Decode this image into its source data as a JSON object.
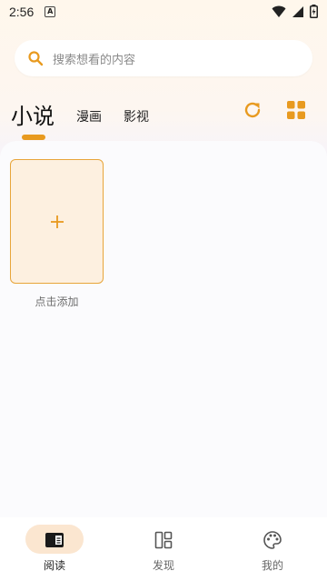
{
  "status_bar": {
    "time": "2:56",
    "app_badge": "A"
  },
  "search": {
    "placeholder": "搜索想看的内容"
  },
  "tabs": [
    {
      "label": "小说",
      "active": true
    },
    {
      "label": "漫画",
      "active": false
    },
    {
      "label": "影视",
      "active": false
    }
  ],
  "toolbar": {
    "refresh_icon": "refresh-icon",
    "grid_icon": "grid-view-icon"
  },
  "shelf": {
    "add_label": "点击添加",
    "add_icon": "plus-icon"
  },
  "bottom_nav": [
    {
      "label": "阅读",
      "icon": "book-icon",
      "active": true
    },
    {
      "label": "发现",
      "icon": "layout-icon",
      "active": false
    },
    {
      "label": "我的",
      "icon": "palette-icon",
      "active": false
    }
  ],
  "colors": {
    "accent": "#e89a1f",
    "card_bg": "#fdf0e0",
    "nav_pill": "#fbe6d0"
  }
}
